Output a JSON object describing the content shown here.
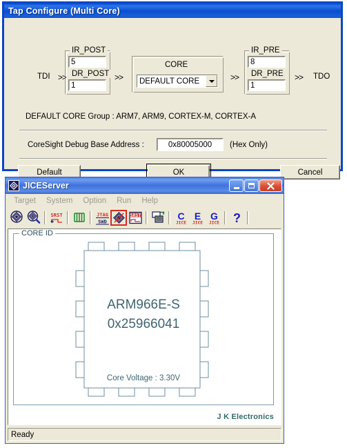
{
  "tap_dialog": {
    "title": "Tap Configure (Multi Core)",
    "tdi_label": "TDI",
    "tdo_label": "TDO",
    "arrow": ">>",
    "post_group": {
      "ir_legend": "IR_POST",
      "ir_value": "5",
      "dr_legend": "DR_POST",
      "dr_value": "1"
    },
    "core_group": {
      "legend": "CORE",
      "selected": "DEFAULT CORE"
    },
    "pre_group": {
      "ir_legend": "IR_PRE",
      "ir_value": "8",
      "dr_legend": "DR_PRE",
      "dr_value": "1"
    },
    "group_note": "DEFAULT CORE Group : ARM7, ARM9, CORTEX-M, CORTEX-A",
    "coresight_label": "CoreSight Debug Base Address :",
    "coresight_value": "0x80005000",
    "coresight_hint": "(Hex Only)",
    "buttons": {
      "default": "Default",
      "ok": "OK",
      "cancel": "Cancel"
    }
  },
  "jice": {
    "title": "JICEServer",
    "app_icon": "jice-diamond-icon",
    "window_buttons": [
      {
        "name": "minimize-button",
        "glyph": "minimize-icon"
      },
      {
        "name": "maximize-button",
        "glyph": "maximize-icon"
      },
      {
        "name": "close-button",
        "glyph": "close-icon"
      }
    ],
    "menu": [
      "Target",
      "System",
      "Option",
      "Run",
      "Help"
    ],
    "toolbar": [
      {
        "name": "core-detect-icon",
        "label": ""
      },
      {
        "name": "core-scan-icon",
        "label": ""
      },
      {
        "name": "srst-icon",
        "label": "SRST"
      },
      {
        "name": "jtag-clock-icon",
        "label": ""
      },
      {
        "name": "jtag-swd-icon",
        "label": "JTAG SWD"
      },
      {
        "name": "tap-configure-icon",
        "label": "",
        "active": true
      },
      {
        "name": "srst-config-icon",
        "label": "SRST"
      },
      {
        "name": "multi-target-icon",
        "label": ""
      },
      {
        "name": "c-jice-icon",
        "label": "C"
      },
      {
        "name": "e-jice-icon",
        "label": "E"
      },
      {
        "name": "g-jice-icon",
        "label": "G"
      },
      {
        "name": "help-icon",
        "label": "?"
      }
    ],
    "core_id": {
      "legend": "CORE ID",
      "chip_name": "ARM966E-S",
      "chip_id": "0x25966041",
      "voltage": "Core Voltage : 3.30V"
    },
    "branding": "J K Electronics",
    "status": "Ready"
  },
  "colors": {
    "dialog_face": "#ece9d8",
    "dialog_border": "#0a46c8",
    "titlebar_blue": "#0b4fd0",
    "jice_titlebar_blue": "#3f72dc",
    "active_tool_red": "#d42b1e",
    "chip_text": "#3e6470",
    "brand_green": "#2f6b66",
    "group_border": "#7e9aa8"
  }
}
